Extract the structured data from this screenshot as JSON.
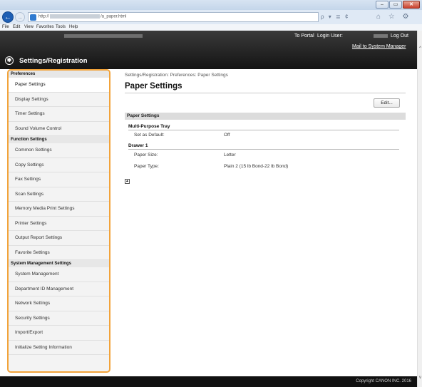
{
  "browser": {
    "url_prefix": "http://",
    "url_suffix": "/a_paper.html",
    "menu": [
      "File",
      "Edit",
      "View",
      "Favorites",
      "Tools",
      "Help"
    ],
    "win_min": "–",
    "win_max": "▭",
    "win_close": "✕",
    "url_controls": "ρ ▾ ≣ ¢",
    "toolbar_icons": "⌂ ☆ ⚙"
  },
  "header": {
    "to_portal": "To Portal",
    "login_user": "Login User:",
    "log_out": "Log Out",
    "mail_to": "Mail to System Manager",
    "site_title": "Settings/Registration",
    "logo_glyph": "✱"
  },
  "sidebar": {
    "sections": [
      {
        "title": "Preferences",
        "items": [
          "Paper Settings",
          "Display Settings",
          "Timer Settings",
          "Sound Volume Control"
        ]
      },
      {
        "title": "Function Settings",
        "items": [
          "Common Settings",
          "Copy Settings",
          "Fax Settings",
          "Scan Settings",
          "Memory Media Print Settings",
          "Printer Settings",
          "Output Report Settings",
          "Favorite Settings"
        ]
      },
      {
        "title": "System Management Settings",
        "items": [
          "System Management",
          "Department ID Management",
          "Network Settings",
          "Security Settings",
          "Import/Export",
          "Initialize Setting Information"
        ]
      }
    ],
    "active_item": "Paper Settings"
  },
  "main": {
    "breadcrumb": "Settings/Registration: Preferences: Paper Settings",
    "title": "Paper Settings",
    "edit_label": "Edit...",
    "section_title": "Paper Settings",
    "mp_tray": {
      "title": "Multi-Purpose Tray",
      "set_default_label": "Set as Default:",
      "set_default_value": "Off"
    },
    "drawer1": {
      "title": "Drawer 1",
      "size_label": "Paper Size:",
      "size_value": "Letter",
      "type_label": "Paper Type:",
      "type_value": "Plain 2 (15 lb Bond-22 lb Bond)"
    },
    "to_top_glyph": "▲"
  },
  "footer": {
    "copyright": "Copyright CANON INC. 2016"
  },
  "colors": {
    "sidebar_highlight": "#f2a33a",
    "header_bg": "#1e1e1e"
  }
}
